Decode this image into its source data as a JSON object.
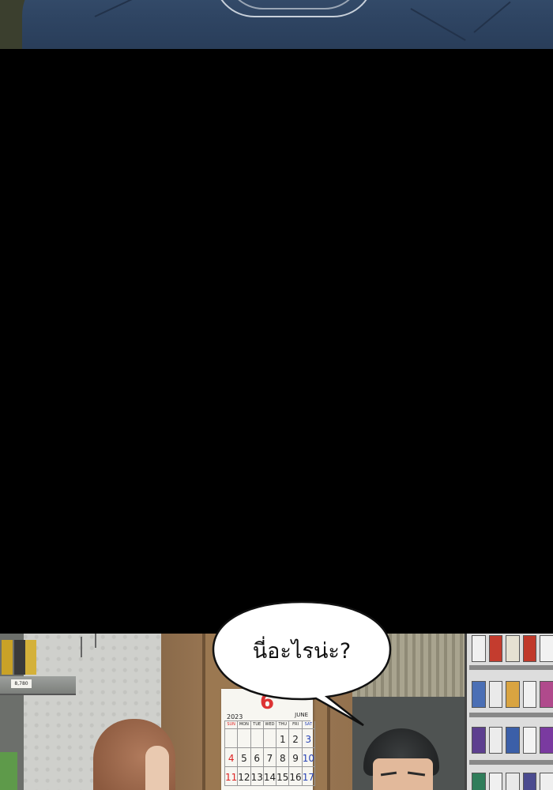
{
  "speech_bubble": {
    "text": "นี่อะไรน่ะ?"
  },
  "calendar": {
    "year": "2023",
    "month_number": "6",
    "month_name": "JUNE",
    "weekdays": [
      "SUN",
      "MON",
      "TUE",
      "WED",
      "THU",
      "FRI",
      "SAT"
    ],
    "rows": [
      [
        "",
        "",
        "",
        "",
        "1",
        "2",
        "3"
      ],
      [
        "4",
        "5",
        "6",
        "7",
        "8",
        "9",
        "10"
      ],
      [
        "11",
        "12",
        "13",
        "14",
        "15",
        "16",
        "17"
      ]
    ]
  },
  "price_tag": "8,780"
}
